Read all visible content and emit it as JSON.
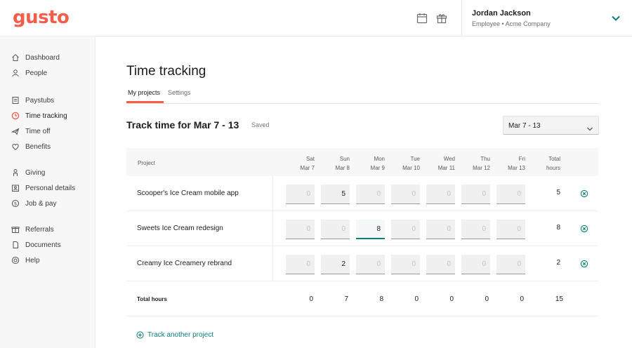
{
  "brand": {
    "logo_text": "gusto",
    "accent": "#f45d48",
    "teal": "#0a7d7d"
  },
  "header": {
    "icons": [
      "calendar-icon",
      "gift-icon"
    ],
    "user_name": "Jordan Jackson",
    "user_subtitle": "Employee • Acme Company"
  },
  "sidebar": {
    "groups": [
      [
        {
          "label": "Dashboard",
          "icon": "home-icon"
        },
        {
          "label": "People",
          "icon": "person-icon"
        }
      ],
      [
        {
          "label": "Paystubs",
          "icon": "paystub-icon"
        },
        {
          "label": "Time tracking",
          "icon": "clock-icon",
          "active": true
        },
        {
          "label": "Time off",
          "icon": "plane-icon"
        },
        {
          "label": "Benefits",
          "icon": "heart-icon"
        }
      ],
      [
        {
          "label": "Giving",
          "icon": "giving-icon"
        },
        {
          "label": "Personal details",
          "icon": "id-card-icon"
        },
        {
          "label": "Job & pay",
          "icon": "dollar-icon"
        }
      ],
      [
        {
          "label": "Referrals",
          "icon": "referral-icon"
        },
        {
          "label": "Documents",
          "icon": "document-icon"
        },
        {
          "label": "Help",
          "icon": "help-icon"
        }
      ]
    ]
  },
  "page": {
    "title": "Time tracking",
    "tabs": [
      {
        "label": "My projects",
        "active": true
      },
      {
        "label": "Settings",
        "active": false
      }
    ],
    "section_title": "Track time for Mar 7 - 13",
    "saved_label": "Saved",
    "week_select": "Mar 7 - 13"
  },
  "table": {
    "project_header": "Project",
    "days": [
      {
        "day": "Sat",
        "date": "Mar 7"
      },
      {
        "day": "Sun",
        "date": "Mar 8"
      },
      {
        "day": "Mon",
        "date": "Mar 9"
      },
      {
        "day": "Tue",
        "date": "Mar 10"
      },
      {
        "day": "Wed",
        "date": "Mar 11"
      },
      {
        "day": "Thu",
        "date": "Mar 12"
      },
      {
        "day": "Fri",
        "date": "Mar 13"
      }
    ],
    "total_header": [
      "Total",
      "hours"
    ],
    "rows": [
      {
        "project": "Scooper's Ice Cream mobile app",
        "hours": [
          "0",
          "5",
          "0",
          "0",
          "0",
          "0",
          "0"
        ],
        "filled": [
          false,
          true,
          false,
          false,
          false,
          false,
          false
        ],
        "total": "5"
      },
      {
        "project": "Sweets Ice Cream redesign",
        "hours": [
          "0",
          "0",
          "8",
          "0",
          "0",
          "0",
          "0"
        ],
        "filled": [
          false,
          false,
          true,
          false,
          false,
          false,
          false
        ],
        "focused": 2,
        "total": "8"
      },
      {
        "project": "Creamy Ice Creamery rebrand",
        "hours": [
          "0",
          "2",
          "0",
          "0",
          "0",
          "0",
          "0"
        ],
        "filled": [
          false,
          true,
          false,
          false,
          false,
          false,
          false
        ],
        "total": "2"
      }
    ],
    "totals_label": "Total hours",
    "day_totals": [
      "0",
      "7",
      "8",
      "0",
      "0",
      "0",
      "0"
    ],
    "grand_total": "15"
  },
  "add_project_label": "Track another project"
}
